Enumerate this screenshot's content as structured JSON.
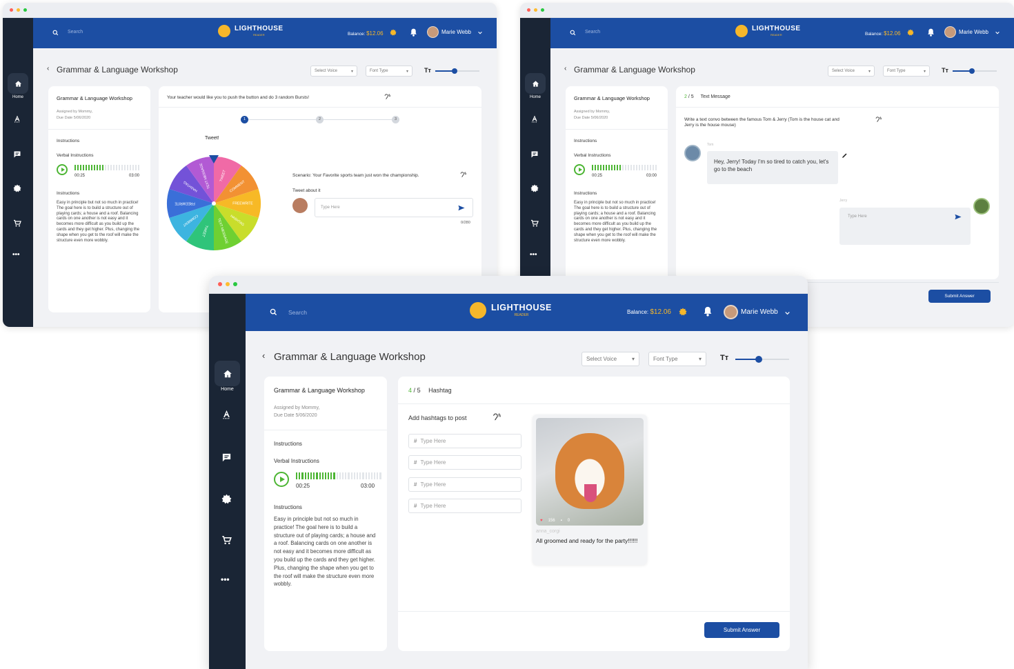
{
  "app": {
    "brand": "LIGHTHOUSE",
    "brand_sub": "READER",
    "search_placeholder": "Search",
    "balance_label": "Balance:",
    "balance_value": "$12.06",
    "user_name": "Marie Webb",
    "page_title": "Grammar & Language Workshop",
    "select_voice": "Select Voice",
    "font_type": "Font Type",
    "font_size_icon": "Tт",
    "text_slider_level": 0.55
  },
  "nav": {
    "home_label": "Home",
    "more_label": "•••"
  },
  "assignment": {
    "title": "Grammar & Language Workshop",
    "assigned_by": "Assigned by Mommy,",
    "due_date": "Due Date 5/06/2020",
    "instructions_heading": "Instructions",
    "verbal_heading": "Verbal Instructions",
    "time_elapsed": "00:25",
    "time_total": "03:00",
    "audio_progress": 0.45,
    "instructions_heading_2": "Instructions",
    "instructions_text": "Easy in principle but not so much in practice! The goal here is to build a structure out of playing cards; a house and a roof. Balancing cards on one another is not easy and it becomes more difficult as you build up the cards and they get higher. Plus, changing the shape when you get to the roof will make the structure even more wobbly."
  },
  "screen1": {
    "prompt": "Your teacher would like you to push the button and do 3 random Bursts!",
    "steps": [
      "1",
      "2",
      "3"
    ],
    "wheel_label": "Tweet!",
    "wheel_segments": [
      "TWEET",
      "COMMENT",
      "FREEWRITE",
      "HASHTAG",
      "TEXT MESSAGE",
      "TWEET",
      "COMMENT",
      "FREEWRITE",
      "HASHTAG",
      "TEXT MESSAGE"
    ],
    "wheel_colors": [
      "#f06aa6",
      "#f29133",
      "#f7b926",
      "#c9dd2b",
      "#6fd032",
      "#2fc47a",
      "#3db4e0",
      "#3a6fd8",
      "#7352d8",
      "#b25ad4"
    ],
    "scenario": "Scenario: Your Favorite sports team just won the championship.",
    "tweet_about": "Tweet about it",
    "input_placeholder": "Type Here",
    "counter": "0/280"
  },
  "screen2": {
    "step_current": "2",
    "step_sep": "/",
    "step_total": "5",
    "step_name": "Text Message",
    "prompt": "Write a text convo between the famous Tom & Jerry (Tom is the house cat and Jerry is the house mouse)",
    "tom_label": "Tom",
    "tom_message": "Hey, Jerry! Today I'm so tired to catch you, let's go to the beach",
    "jerry_label": "Jerry",
    "input_placeholder": "Type Here",
    "submit": "Submit Answer"
  },
  "screen3": {
    "step_current": "4",
    "step_sep": "/",
    "step_total": "5",
    "step_name": "Hashtag",
    "prompt": "Add hashtags to post",
    "hashtag_placeholders": [
      "Type Here",
      "Type Here",
      "Type Here",
      "Type Here"
    ],
    "hash_symbol": "#",
    "post_likes": "156",
    "post_comments": "0",
    "post_user": "anna_corgi",
    "post_caption": "All groomed and ready for the party!!!!!!",
    "submit": "Submit Answer"
  }
}
